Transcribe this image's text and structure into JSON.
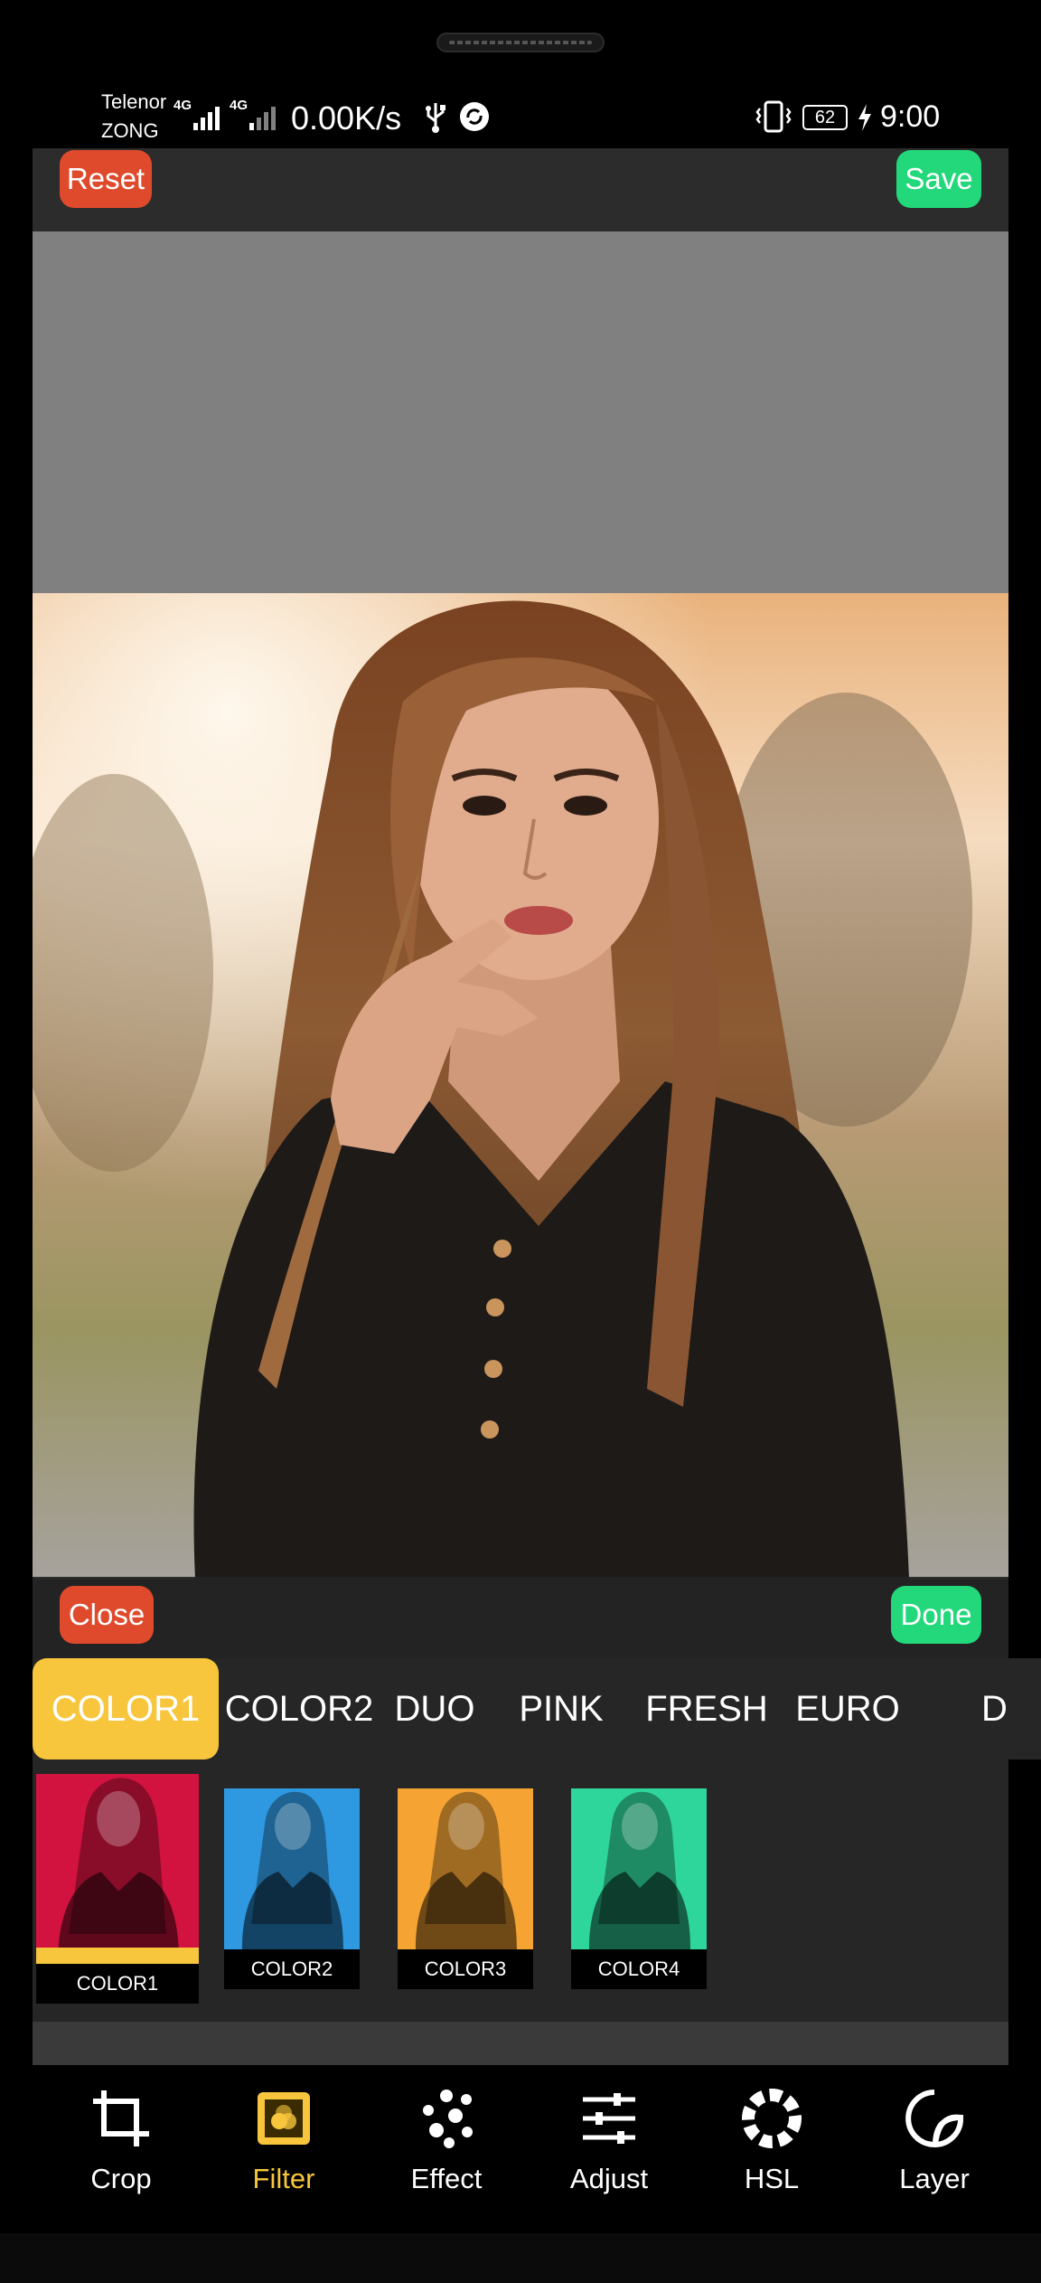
{
  "status_bar": {
    "carrier_1": "Telenor",
    "carrier_2": "ZONG",
    "network_1": "4G",
    "network_2": "4G",
    "speed": "0.00K/s",
    "battery": "62",
    "time": "9:00",
    "icons": [
      "signal-icon",
      "usb-icon",
      "sync-icon",
      "vibrate-icon",
      "charging-icon"
    ]
  },
  "top_bar": {
    "reset_label": "Reset",
    "save_label": "Save"
  },
  "filter_panel": {
    "close_label": "Close",
    "done_label": "Done",
    "tabs": [
      {
        "label": "COLOR1",
        "active": true
      },
      {
        "label": "COLOR2",
        "active": false
      },
      {
        "label": "DUO",
        "active": false
      },
      {
        "label": "PINK",
        "active": false
      },
      {
        "label": "FRESH",
        "active": false
      },
      {
        "label": "EURO",
        "active": false
      },
      {
        "label": "D",
        "active": false
      }
    ],
    "thumbnails": [
      {
        "label": "COLOR1",
        "tint": "#d3133f",
        "selected": true
      },
      {
        "label": "COLOR2",
        "tint": "#2e98e0",
        "selected": false
      },
      {
        "label": "COLOR3",
        "tint": "#f5a433",
        "selected": false
      },
      {
        "label": "COLOR4",
        "tint": "#2fd69b",
        "selected": false
      }
    ]
  },
  "bottom_nav": {
    "items": [
      {
        "label": "Crop",
        "icon": "crop-icon",
        "selected": false
      },
      {
        "label": "Filter",
        "icon": "filter-icon",
        "selected": true
      },
      {
        "label": "Effect",
        "icon": "effect-icon",
        "selected": false
      },
      {
        "label": "Adjust",
        "icon": "adjust-icon",
        "selected": false
      },
      {
        "label": "HSL",
        "icon": "hsl-icon",
        "selected": false
      },
      {
        "label": "Layer",
        "icon": "sticker-icon",
        "selected": false
      }
    ]
  },
  "colors": {
    "accent": "#f8c63c",
    "reset": "#df4a2c",
    "save": "#22d87a"
  }
}
